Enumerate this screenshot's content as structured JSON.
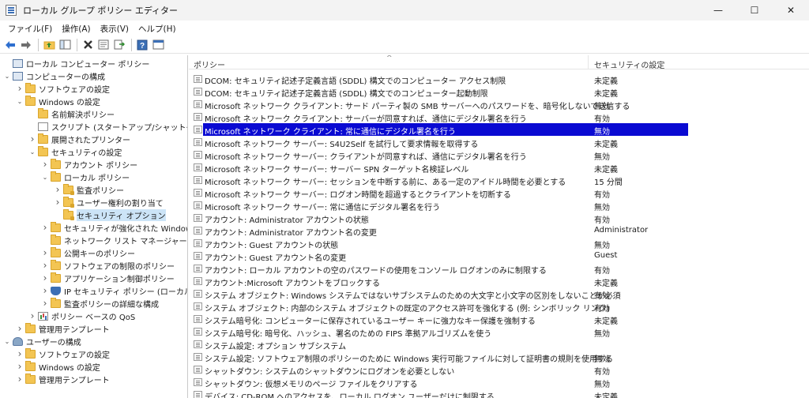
{
  "window": {
    "title": "ローカル グループ ポリシー エディター",
    "minimize": "—",
    "maximize": "☐",
    "close": "✕"
  },
  "menu": [
    "ファイル(F)",
    "操作(A)",
    "表示(V)",
    "ヘルプ(H)"
  ],
  "toolbar": {
    "icons": [
      "back-icon",
      "forward-icon",
      "up-folder-icon",
      "show-tree-icon",
      "delete-icon",
      "properties-icon",
      "export-icon",
      "help-icon",
      "view-icon"
    ]
  },
  "tree": [
    {
      "label": "ローカル コンピューター ポリシー",
      "depth": 0,
      "icon": "computer",
      "exp": ""
    },
    {
      "label": "コンピューターの構成",
      "depth": 0,
      "icon": "computer",
      "exp": "v"
    },
    {
      "label": "ソフトウェアの設定",
      "depth": 1,
      "icon": "folder",
      "exp": ">"
    },
    {
      "label": "Windows の設定",
      "depth": 1,
      "icon": "folder",
      "exp": "v"
    },
    {
      "label": "名前解決ポリシー",
      "depth": 2,
      "icon": "folder",
      "exp": ""
    },
    {
      "label": "スクリプト (スタートアップ/シャットダウン)",
      "depth": 2,
      "icon": "doc",
      "exp": ""
    },
    {
      "label": "展開されたプリンター",
      "depth": 2,
      "icon": "folder",
      "exp": ">"
    },
    {
      "label": "セキュリティの設定",
      "depth": 2,
      "icon": "folder",
      "exp": "v"
    },
    {
      "label": "アカウント ポリシー",
      "depth": 3,
      "icon": "folder",
      "exp": ">"
    },
    {
      "label": "ローカル ポリシー",
      "depth": 3,
      "icon": "folder",
      "exp": "v"
    },
    {
      "label": "監査ポリシー",
      "depth": 4,
      "icon": "folder-locked",
      "exp": ">"
    },
    {
      "label": "ユーザー権利の割り当て",
      "depth": 4,
      "icon": "folder-locked",
      "exp": ">"
    },
    {
      "label": "セキュリティ オプション",
      "depth": 4,
      "icon": "folder-locked",
      "exp": "",
      "selected": true
    },
    {
      "label": "セキュリティが強化された Windows D",
      "depth": 3,
      "icon": "folder",
      "exp": ">"
    },
    {
      "label": "ネットワーク リスト マネージャー ポリシー",
      "depth": 3,
      "icon": "folder",
      "exp": ""
    },
    {
      "label": "公開キーのポリシー",
      "depth": 3,
      "icon": "folder",
      "exp": ">"
    },
    {
      "label": "ソフトウェアの制限のポリシー",
      "depth": 3,
      "icon": "folder",
      "exp": ">"
    },
    {
      "label": "アプリケーション制御ポリシー",
      "depth": 3,
      "icon": "folder",
      "exp": ">"
    },
    {
      "label": "IP セキュリティ ポリシー (ローカル コンピ",
      "depth": 3,
      "icon": "shield",
      "exp": ">"
    },
    {
      "label": "監査ポリシーの詳細な構成",
      "depth": 3,
      "icon": "folder",
      "exp": ">"
    },
    {
      "label": "ポリシー ベースの QoS",
      "depth": 2,
      "icon": "chart",
      "exp": ">"
    },
    {
      "label": "管理用テンプレート",
      "depth": 1,
      "icon": "folder",
      "exp": ">"
    },
    {
      "label": "ユーザーの構成",
      "depth": 0,
      "icon": "user",
      "exp": "v"
    },
    {
      "label": "ソフトウェアの設定",
      "depth": 1,
      "icon": "folder",
      "exp": ">"
    },
    {
      "label": "Windows の設定",
      "depth": 1,
      "icon": "folder",
      "exp": ">"
    },
    {
      "label": "管理用テンプレート",
      "depth": 1,
      "icon": "folder",
      "exp": ">"
    }
  ],
  "list": {
    "header_policy": "ポリシー",
    "header_setting": "セキュリティの設定",
    "sort_caret": "^",
    "rows": [
      {
        "policy": "DCOM: セキュリティ記述子定義言語 (SDDL) 構文でのコンピューター アクセス制限",
        "setting": "未定義"
      },
      {
        "policy": "DCOM: セキュリティ記述子定義言語 (SDDL) 構文でのコンピューター起動制限",
        "setting": "未定義"
      },
      {
        "policy": "Microsoft ネットワーク クライアント: サード パーティ製の SMB サーバーへのパスワードを、暗号化しないで送信する",
        "setting": "無効"
      },
      {
        "policy": "Microsoft ネットワーク クライアント: サーバーが同意すれば、通信にデジタル署名を行う",
        "setting": "有効"
      },
      {
        "policy": "Microsoft ネットワーク クライアント: 常に通信にデジタル署名を行う",
        "setting": "無効",
        "selected": true
      },
      {
        "policy": "Microsoft ネットワーク サーバー: S4U2Self を試行して要求情報を取得する",
        "setting": "未定義"
      },
      {
        "policy": "Microsoft ネットワーク サーバー: クライアントが同意すれば、通信にデジタル署名を行う",
        "setting": "無効"
      },
      {
        "policy": "Microsoft ネットワーク サーバー: サーバー SPN ターゲット名検証レベル",
        "setting": "未定義"
      },
      {
        "policy": "Microsoft ネットワーク サーバー: セッションを中断する前に、ある一定のアイドル時間を必要とする",
        "setting": "15 分間"
      },
      {
        "policy": "Microsoft ネットワーク サーバー: ログオン時間を超過するとクライアントを切断する",
        "setting": "有効"
      },
      {
        "policy": "Microsoft ネットワーク サーバー: 常に通信にデジタル署名を行う",
        "setting": "無効"
      },
      {
        "policy": "アカウント: Administrator アカウントの状態",
        "setting": "有効"
      },
      {
        "policy": "アカウント: Administrator アカウント名の変更",
        "setting": "Administrator"
      },
      {
        "policy": "アカウント: Guest アカウントの状態",
        "setting": "無効"
      },
      {
        "policy": "アカウント: Guest アカウント名の変更",
        "setting": "Guest"
      },
      {
        "policy": "アカウント: ローカル アカウントの空のパスワードの使用をコンソール ログオンのみに制限する",
        "setting": "有効"
      },
      {
        "policy": "アカウント:Microsoft アカウントをブロックする",
        "setting": "未定義"
      },
      {
        "policy": "システム オブジェクト: Windows システムではないサブシステムのための大文字と小文字の区別をしないことが必須",
        "setting": "有効"
      },
      {
        "policy": "システム オブジェクト: 内部のシステム オブジェクトの既定のアクセス許可を強化する (例: シンボリック リンク)",
        "setting": "有効"
      },
      {
        "policy": "システム暗号化: コンピューターに保存されているユーザー キーに強力なキー保護を強制する",
        "setting": "未定義"
      },
      {
        "policy": "システム暗号化: 暗号化、ハッシュ、署名のための FIPS 準拠アルゴリズムを使う",
        "setting": "無効"
      },
      {
        "policy": "システム設定: オプション サブシステム",
        "setting": ""
      },
      {
        "policy": "システム設定: ソフトウェア制限のポリシーのために Windows 実行可能ファイルに対して証明書の規則を使用する",
        "setting": "無効"
      },
      {
        "policy": "シャットダウン: システムのシャットダウンにログオンを必要としない",
        "setting": "有効"
      },
      {
        "policy": "シャットダウン: 仮想メモリのページ ファイルをクリアする",
        "setting": "無効"
      },
      {
        "policy": "デバイス: CD-ROM へのアクセスを、ローカル ログオン ユーザーだけに制限する",
        "setting": "未定義"
      }
    ]
  }
}
